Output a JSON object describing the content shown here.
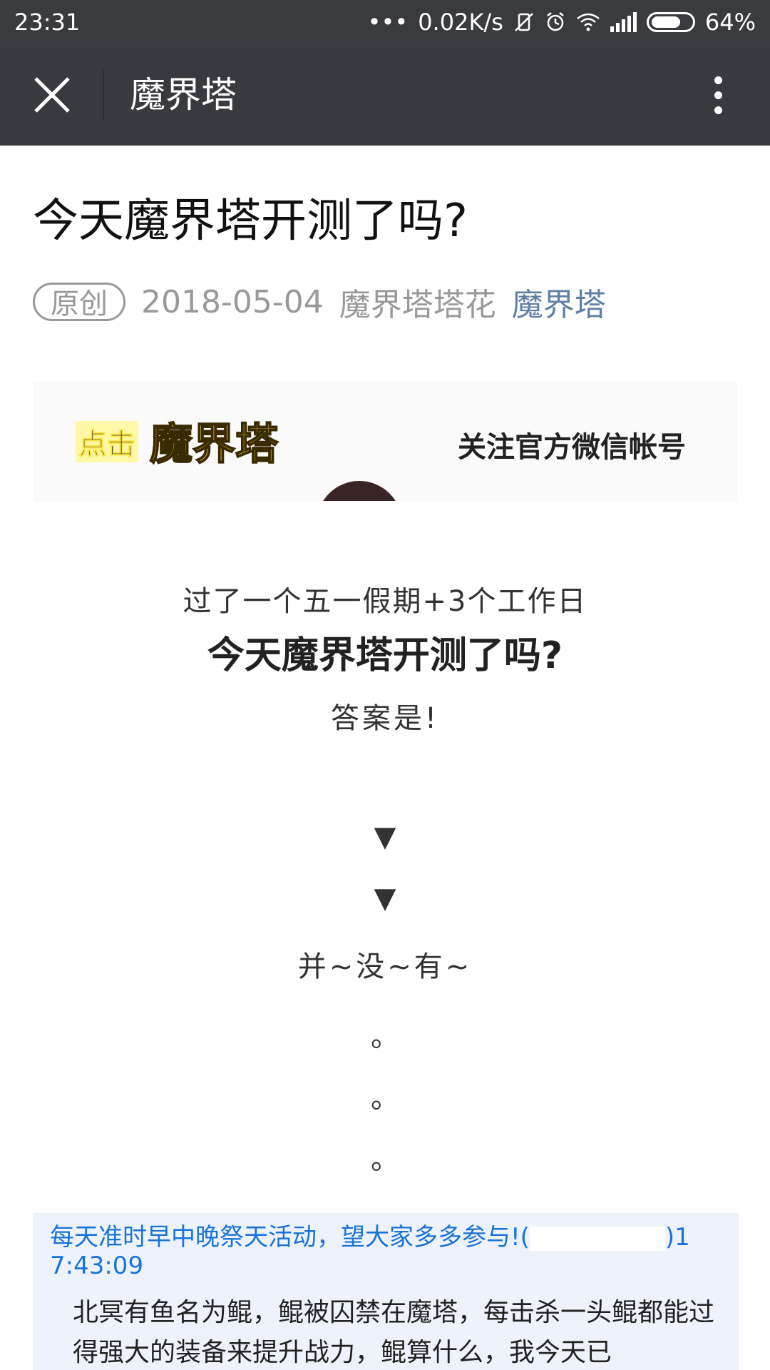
{
  "status_bar": {
    "time": "23:31",
    "dots": "•••",
    "speed": "0.02K/s",
    "battery": "64%",
    "icons": [
      "vibrate-off-icon",
      "alarm-icon",
      "wifi-icon",
      "signal-icon",
      "battery-icon"
    ]
  },
  "app_bar": {
    "title": "魔界塔",
    "close_icon": "close-icon",
    "more_icon": "more-vertical-icon"
  },
  "article": {
    "title": "今天魔界塔开测了吗?",
    "badge": "原创",
    "date": "2018-05-04",
    "author": "魔界塔塔花",
    "account": "魔界塔"
  },
  "banner": {
    "click": "点击",
    "brand": "魔界塔",
    "follow": "关注官方微信帐号"
  },
  "content": {
    "line1": "过了一个五一假期+3个工作日",
    "line2": "今天魔界塔开测了吗?",
    "line3": "答案是!",
    "arrow": "▼",
    "line4": "并~没~有~",
    "dot": "。"
  },
  "chat": {
    "head_prefix": "每天准时早中晚祭天活动，望大家多多参与!(",
    "head_suffix": ")1",
    "head_time": "7:43:09",
    "body": "北冥有鱼名为鲲，鲲被囚禁在魔塔，每击杀一头鲲都能过得强大的装备来提升战力，鲲算什么，我今天已"
  },
  "colors": {
    "status_bar_bg": "#3a3b3e",
    "app_bar_bg": "#393a3f",
    "link": "#607fa6",
    "chat_head": "#1a73d9"
  }
}
